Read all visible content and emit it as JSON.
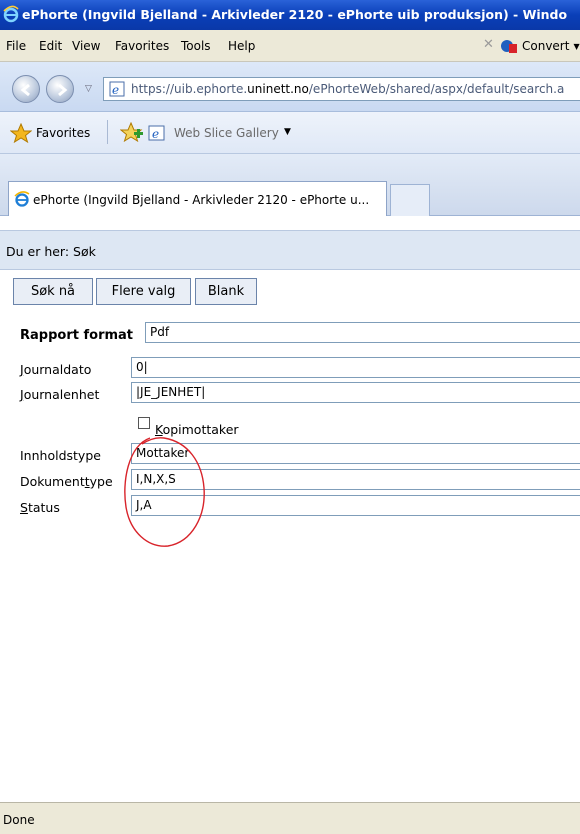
{
  "window": {
    "title": "ePhorte (Ingvild Bjelland - Arkivleder 2120 - ePhorte uib produksjon) - Windo"
  },
  "menu": {
    "items": [
      "File",
      "Edit",
      "View",
      "Favorites",
      "Tools",
      "Help"
    ],
    "convert_label": "Convert"
  },
  "address": {
    "url_prefix": "https://uib.ephorte.",
    "url_domain": "uninett.no",
    "url_suffix": "/ePhorteWeb/shared/aspx/default/search.a"
  },
  "favorites_bar": {
    "favorites_label": "Favorites",
    "web_slice_label": "Web Slice Gallery"
  },
  "tab": {
    "label": "ePhorte (Ingvild Bjelland - Arkivleder 2120 - ePhorte u..."
  },
  "page": {
    "breadcrumb": "Du er her: Søk",
    "buttons": {
      "search_now": "Søk nå",
      "more_options": "Flere valg",
      "blank": "Blank"
    },
    "form": {
      "report_format": {
        "label": "Rapport format",
        "value": "Pdf"
      },
      "journal_date": {
        "label_first": "J",
        "label_rest": "ournaldato",
        "value": "0|"
      },
      "journal_unit": {
        "label_first": "J",
        "label_rest": "ournalenhet",
        "value": "|JE_JENHET|"
      },
      "copy_recipient": {
        "label_first": "K",
        "label_rest": "opimottaker",
        "checked": false
      },
      "content_type": {
        "label": "Innholdstype",
        "value": "Mottaker"
      },
      "document_type": {
        "label_pre": "Dokument",
        "label_underlined": "t",
        "label_post": "ype",
        "value": "I,N,X,S"
      },
      "status": {
        "label_first": "S",
        "label_rest": "tatus",
        "value": "J,A"
      }
    }
  },
  "statusbar": {
    "text": "Done"
  },
  "colors": {
    "title_bar": "#0a3fb8",
    "highlight_circle": "#d8232a"
  }
}
